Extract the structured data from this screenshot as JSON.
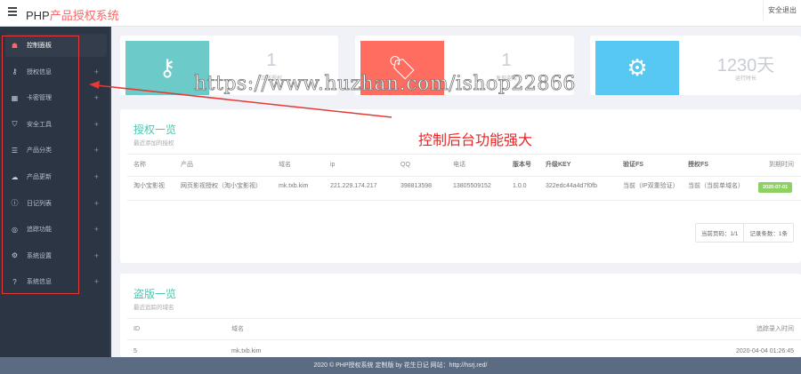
{
  "header": {
    "brand_prefix": "PHP",
    "brand_suffix": "产品授权系统",
    "logout": "安全退出"
  },
  "sidebar": {
    "items": [
      {
        "label": "控制面板",
        "icon": "dashboard-icon",
        "active": true
      },
      {
        "label": "授权信息",
        "icon": "key-icon"
      },
      {
        "label": "卡密管理",
        "icon": "card-icon"
      },
      {
        "label": "安全工具",
        "icon": "shield-icon"
      },
      {
        "label": "产品分类",
        "icon": "list-icon"
      },
      {
        "label": "产品更新",
        "icon": "cloud-upload-icon"
      },
      {
        "label": "日记列表",
        "icon": "info-icon"
      },
      {
        "label": "追踪功能",
        "icon": "target-icon"
      },
      {
        "label": "系统设置",
        "icon": "cogs-icon"
      },
      {
        "label": "系统信息",
        "icon": "question-icon"
      }
    ],
    "expand": "+"
  },
  "stats": [
    {
      "value": "1",
      "label": "正版授权",
      "color": "#6ccac9",
      "icon": "key-icon"
    },
    {
      "value": "1",
      "label": "发现盗版",
      "color": "#ff6c60",
      "icon": "tag-icon"
    },
    {
      "value": "1230天",
      "label": "运行时长",
      "color": "#57c8f2",
      "icon": "cogs-icon"
    }
  ],
  "auth": {
    "title": "授权一览",
    "subtitle": "最近添加的授权",
    "columns": [
      "名称",
      "产品",
      "域名",
      "ip",
      "QQ",
      "电话",
      "版本号",
      "升级KEY",
      "验证FS",
      "授权FS",
      "到期时间"
    ],
    "rows": [
      [
        "淘小宝影视",
        "网页影视授权（淘小宝影视）",
        "mk.txb.kim",
        "221.229.174.217",
        "398813598",
        "13805509152",
        "1.0.0",
        "322edc44a4d7f0fb",
        "当前（IP双重验证）",
        "当前（当前单域名）",
        "2020-07-01"
      ]
    ],
    "page": "当前页码：1/1",
    "count": "记录条数：1条"
  },
  "piracy": {
    "title": "盗版一览",
    "subtitle": "最近追踪的域名",
    "columns": [
      "ID",
      "域名",
      "追踪录入时间"
    ],
    "rows": [
      [
        "5",
        "mk.txb.kim",
        "2020-04-04 01:26:45"
      ]
    ]
  },
  "footer": "2020 © PHP授权系统 定制版 by 花生日记 网站：http://hsrj.red/",
  "overlay": {
    "watermark": "https://www.huzhan.com/ishop22866",
    "annotation": "控制后台功能强大"
  }
}
